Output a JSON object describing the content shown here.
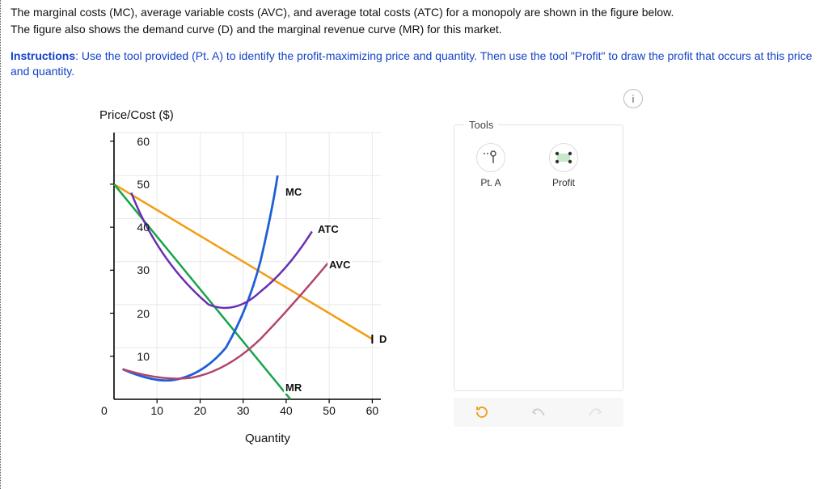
{
  "intro_line1": "The marginal costs (MC), average variable costs (AVC), and average total costs (ATC) for a monopoly are shown in the figure below.",
  "intro_line2": "The figure also shows the demand curve (D) and the marginal revenue curve (MR) for this market.",
  "instructions_label": "Instructions",
  "instructions_body": ": Use the tool provided (Pt. A) to identify the profit-maximizing price and quantity. Then use the tool \"Profit\" to draw the profit that occurs at this price and quantity.",
  "axis_y_title": "Price/Cost ($)",
  "axis_x_title": "Quantity",
  "tools": {
    "panel_label": "Tools",
    "pointA": "Pt. A",
    "profit": "Profit"
  },
  "info_glyph": "i",
  "ticks_y": [
    "0",
    "10",
    "20",
    "30",
    "40",
    "50",
    "60"
  ],
  "ticks_x": [
    "10",
    "20",
    "30",
    "40",
    "50",
    "60"
  ],
  "curves": {
    "mc": "MC",
    "atc": "ATC",
    "avc": "AVC",
    "d": "D",
    "mr": "MR"
  },
  "chart_data": {
    "type": "line",
    "title": "Monopoly cost, demand and marginal revenue curves",
    "xlabel": "Quantity",
    "ylabel": "Price/Cost ($)",
    "xlim": [
      0,
      62
    ],
    "ylim": [
      0,
      62
    ],
    "grid": true,
    "series": [
      {
        "name": "D",
        "color": "#f39c12",
        "x": [
          0,
          60
        ],
        "y": [
          50,
          14
        ]
      },
      {
        "name": "MR",
        "color": "#16a34a",
        "x": [
          0,
          41
        ],
        "y": [
          50,
          0
        ]
      },
      {
        "name": "MC",
        "color": "#1e5fd6",
        "x": [
          2,
          8,
          14,
          20,
          26,
          30,
          34,
          38
        ],
        "y": [
          7,
          5,
          4.5,
          6,
          12,
          20,
          32,
          52
        ]
      },
      {
        "name": "AVC",
        "color": "#b2456e",
        "x": [
          2,
          10,
          18,
          26,
          34,
          42,
          50
        ],
        "y": [
          7,
          5,
          5,
          8,
          14,
          22,
          32
        ]
      },
      {
        "name": "ATC",
        "color": "#6b2fb3",
        "x": [
          4,
          10,
          16,
          22,
          28,
          34,
          40,
          46
        ],
        "y": [
          48,
          34,
          26,
          22,
          22,
          25,
          31,
          39
        ]
      }
    ]
  }
}
